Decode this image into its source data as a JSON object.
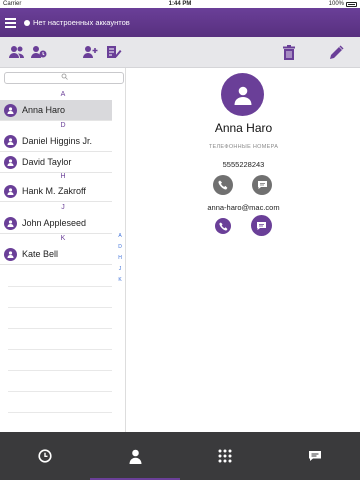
{
  "status_bar": {
    "carrier": "Carrier",
    "time": "1:44 PM",
    "battery": "100%"
  },
  "header": {
    "account_status": "Нет настроенных аккаунтов"
  },
  "toolbar": {
    "left_icons": [
      "contacts-icon",
      "contacts-recent-icon",
      "add-contact-icon",
      "edit-list-icon"
    ],
    "right_icons": [
      "trash-icon",
      "pencil-icon"
    ]
  },
  "contacts": {
    "search_placeholder": "",
    "groups": [
      {
        "letter": "A",
        "items": [
          {
            "name": "Anna Haro",
            "selected": true
          }
        ]
      },
      {
        "letter": "D",
        "items": [
          {
            "name": "Daniel Higgins Jr."
          },
          {
            "name": "David Taylor"
          }
        ]
      },
      {
        "letter": "H",
        "items": [
          {
            "name": "Hank M. Zakroff"
          }
        ]
      },
      {
        "letter": "J",
        "items": [
          {
            "name": "John Appleseed"
          }
        ]
      },
      {
        "letter": "K",
        "items": [
          {
            "name": "Kate Bell"
          }
        ]
      }
    ],
    "index": [
      "A",
      "D",
      "H",
      "J",
      "K"
    ]
  },
  "detail": {
    "name": "Anna Haro",
    "phones_label": "ТЕЛЕФОННЫЕ НОМЕРА",
    "phone": "5555228243",
    "email": "anna-haro@mac.com"
  },
  "tabs": [
    {
      "icon": "clock-icon",
      "active": false
    },
    {
      "icon": "person-icon",
      "active": true
    },
    {
      "icon": "dialpad-icon",
      "active": false
    },
    {
      "icon": "chat-icon",
      "active": false
    }
  ],
  "colors": {
    "accent": "#6a3f98",
    "tabbar": "#3a3a3c",
    "toolbar": "#e7e7ea"
  }
}
